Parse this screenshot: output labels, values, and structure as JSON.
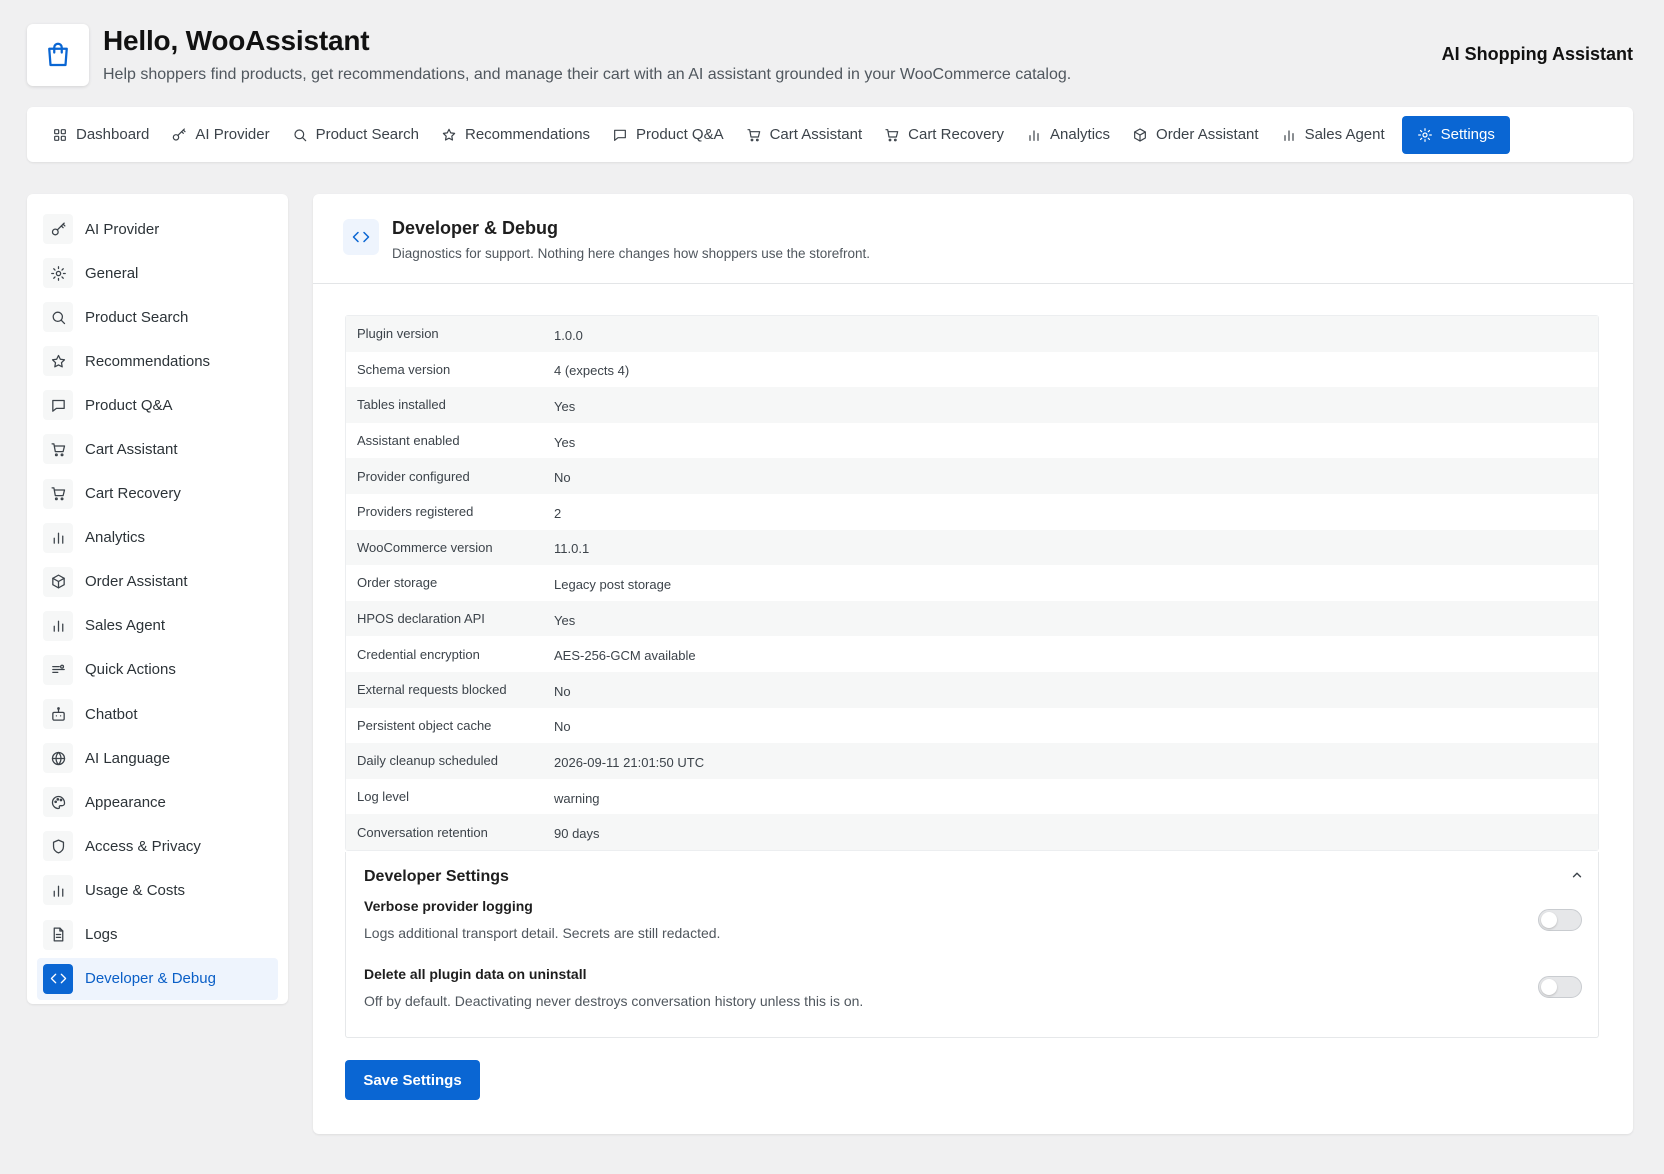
{
  "header": {
    "title": "Hello, WooAssistant",
    "subtitle": "Help shoppers find products, get recommendations, and manage their cart with an AI assistant grounded in your WooCommerce catalog.",
    "product_name": "AI Shopping Assistant"
  },
  "top_nav": [
    {
      "label": "Dashboard",
      "icon": "grid-icon"
    },
    {
      "label": "AI Provider",
      "icon": "key-icon"
    },
    {
      "label": "Product Search",
      "icon": "search-icon"
    },
    {
      "label": "Recommendations",
      "icon": "star-icon"
    },
    {
      "label": "Product Q&A",
      "icon": "comment-icon"
    },
    {
      "label": "Cart Assistant",
      "icon": "cart-icon"
    },
    {
      "label": "Cart Recovery",
      "icon": "cart-icon"
    },
    {
      "label": "Analytics",
      "icon": "bar-chart-icon"
    },
    {
      "label": "Order Assistant",
      "icon": "box-icon"
    },
    {
      "label": "Sales Agent",
      "icon": "bar-chart-icon"
    },
    {
      "label": "Settings",
      "icon": "gear-icon",
      "active": true
    }
  ],
  "sidebar": [
    {
      "label": "AI Provider",
      "icon": "key-icon"
    },
    {
      "label": "General",
      "icon": "gear-icon"
    },
    {
      "label": "Product Search",
      "icon": "search-icon"
    },
    {
      "label": "Recommendations",
      "icon": "star-icon"
    },
    {
      "label": "Product Q&A",
      "icon": "comment-icon"
    },
    {
      "label": "Cart Assistant",
      "icon": "cart-icon"
    },
    {
      "label": "Cart Recovery",
      "icon": "cart-icon"
    },
    {
      "label": "Analytics",
      "icon": "bar-chart-icon"
    },
    {
      "label": "Order Assistant",
      "icon": "box-icon"
    },
    {
      "label": "Sales Agent",
      "icon": "bar-chart-icon"
    },
    {
      "label": "Quick Actions",
      "icon": "actions-icon"
    },
    {
      "label": "Chatbot",
      "icon": "robot-icon"
    },
    {
      "label": "AI Language",
      "icon": "globe-icon"
    },
    {
      "label": "Appearance",
      "icon": "palette-icon"
    },
    {
      "label": "Access & Privacy",
      "icon": "shield-icon"
    },
    {
      "label": "Usage & Costs",
      "icon": "bar-chart-icon"
    },
    {
      "label": "Logs",
      "icon": "document-icon"
    },
    {
      "label": "Developer & Debug",
      "icon": "code-icon",
      "active": true
    }
  ],
  "panel": {
    "title": "Developer & Debug",
    "description": "Diagnostics for support. Nothing here changes how shoppers use the storefront.",
    "icon": "code-icon"
  },
  "diagnostics": [
    {
      "key": "Plugin version",
      "value": "1.0.0"
    },
    {
      "key": "Schema version",
      "value": "4 (expects 4)"
    },
    {
      "key": "Tables installed",
      "value": "Yes"
    },
    {
      "key": "Assistant enabled",
      "value": "Yes"
    },
    {
      "key": "Provider configured",
      "value": "No"
    },
    {
      "key": "Providers registered",
      "value": "2"
    },
    {
      "key": "WooCommerce version",
      "value": "11.0.1"
    },
    {
      "key": "Order storage",
      "value": "Legacy post storage"
    },
    {
      "key": "HPOS declaration API",
      "value": "Yes"
    },
    {
      "key": "Credential encryption",
      "value": "AES-256-GCM available"
    },
    {
      "key": "External requests blocked",
      "value": "No"
    },
    {
      "key": "Persistent object cache",
      "value": "No"
    },
    {
      "key": "Daily cleanup scheduled",
      "value": "2026-09-11 21:01:50 UTC"
    },
    {
      "key": "Log level",
      "value": "warning"
    },
    {
      "key": "Conversation retention",
      "value": "90 days"
    }
  ],
  "developer_settings": {
    "title": "Developer Settings",
    "options": [
      {
        "label": "Verbose provider logging",
        "description": "Logs additional transport detail. Secrets are still redacted.",
        "enabled": false
      },
      {
        "label": "Delete all plugin data on uninstall",
        "description": "Off by default. Deactivating never destroys conversation history unless this is on.",
        "enabled": false
      }
    ]
  },
  "save_label": "Save Settings",
  "colors": {
    "accent": "#0a66d3",
    "background": "#f0f0f1"
  }
}
